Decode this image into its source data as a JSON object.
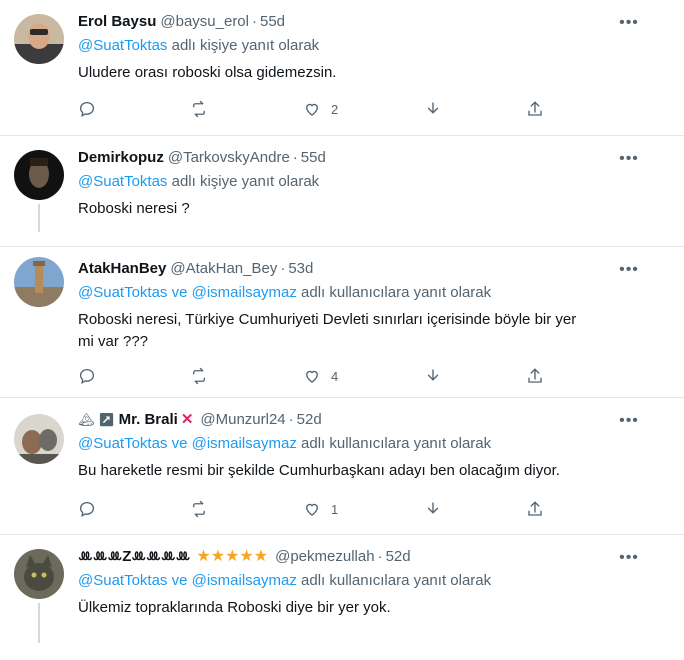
{
  "tweets": [
    {
      "name": "Erol Baysu",
      "handle": "@baysu_erol",
      "time": "55d",
      "reply_prefix": "@SuatToktas",
      "reply_suffix": "adlı kişiye yanıt olarak",
      "text": "Uludere orası roboski olsa gidemezsin.",
      "likes": "2",
      "retweets": ""
    },
    {
      "name": "Demirkopuz",
      "handle": "@TarkovskyAndre",
      "time": "55d",
      "reply_prefix": "@SuatToktas",
      "reply_suffix": "adlı kişiye yanıt olarak",
      "text": "Roboski neresi ?"
    },
    {
      "name": "AtakHanBey",
      "handle": "@AtakHan_Bey",
      "time": "53d",
      "reply_prefix": "@SuatToktas ve @ismailsaymaz",
      "reply_suffix": "adlı kullanıcılara yanıt olarak",
      "text_line1": "Roboski neresi, Türkiye Cumhuriyeti Devleti sınırları içerisinde böyle bir yer",
      "text_line2": "mi var ???",
      "likes": "4"
    },
    {
      "name": "Mr. Brali",
      "handle": "@Munzurl24",
      "time": "52d",
      "reply_prefix": "@SuatToktas ve @ismailsaymaz",
      "reply_suffix": "adlı kullanıcılara yanıt olarak",
      "text": "Bu hareketle resmi bir şekilde Cumhurbaşkanı adayı ben olacağım diyor.",
      "likes": "1"
    },
    {
      "name": "ꔛ͏ꔛꔛ͏Zꔛꔛꔛ͏ꔛ",
      "handle": "@pekmezullah",
      "time": "52d",
      "reply_prefix": "@SuatToktas ve @ismailsaymaz",
      "reply_suffix": "adlı kullanıcılara yanıt olarak",
      "text": "Ülkemiz topraklarında Roboski diye bir yer yok."
    }
  ],
  "ui": {
    "dot": "·",
    "more": "•••",
    "reply_icon": "reply-icon",
    "retweet_icon": "retweet-icon",
    "like_icon": "heart-icon",
    "share_icon": "share-icon",
    "upload_icon": "upload-icon",
    "stars": "★★★★★",
    "brali_prefix": "🏔 ↗",
    "brali_suffix_x": "✕"
  },
  "colors": {
    "accent": "#1d9bf0",
    "text_primary": "#0f1419",
    "text_secondary": "#536471",
    "divider": "#e4e7ea"
  }
}
